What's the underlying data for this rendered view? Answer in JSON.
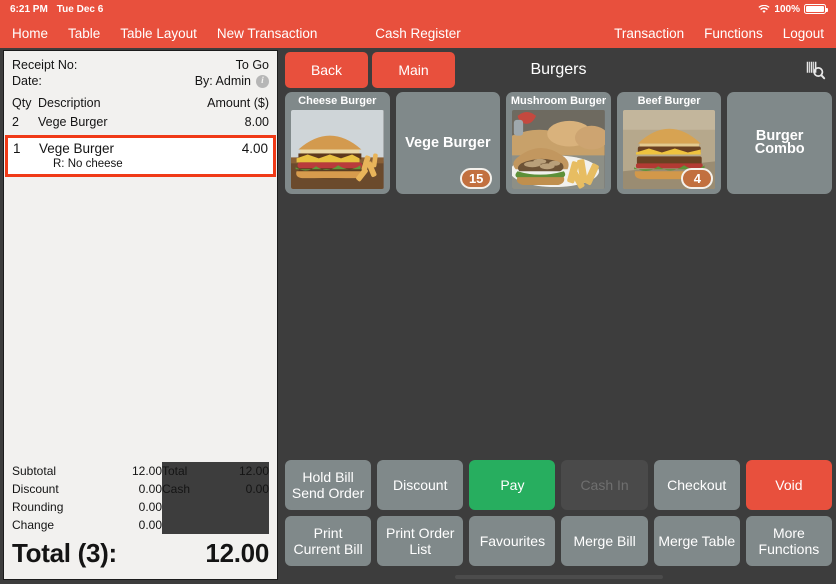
{
  "statusbar": {
    "time": "6:21 PM",
    "date": "Tue Dec 6",
    "wifi_icon": "wifi-icon",
    "battery_percent": "100%",
    "battery_icon": "battery-full-icon"
  },
  "navbar": {
    "title": "Cash Register",
    "left_items": [
      {
        "label": "Home",
        "name": "nav-item-home"
      },
      {
        "label": "Table",
        "name": "nav-item-table"
      },
      {
        "label": "Table Layout",
        "name": "nav-item-table-layout"
      },
      {
        "label": "New Transaction",
        "name": "nav-item-new-transaction"
      }
    ],
    "right_items": [
      {
        "label": "Transaction",
        "name": "nav-item-transaction"
      },
      {
        "label": "Functions",
        "name": "nav-item-functions"
      },
      {
        "label": "Logout",
        "name": "nav-item-logout"
      }
    ]
  },
  "receipt": {
    "receipt_no_label": "Receipt No:",
    "receipt_no_value": "",
    "order_type": "To Go",
    "date_label": "Date:",
    "date_value": "",
    "operator": "By: Admin",
    "info_icon": "info-icon",
    "col_qty": "Qty",
    "col_desc": "Description",
    "col_amount": "Amount ($)",
    "items": [
      {
        "qty": "2",
        "description": "Vege Burger",
        "amount": "8.00",
        "note": "",
        "selected": false
      },
      {
        "qty": "1",
        "description": "Vege Burger",
        "amount": "4.00",
        "note": "R: No cheese",
        "selected": true
      }
    ],
    "totals_left": [
      {
        "label": "Subtotal",
        "value": "12.00"
      },
      {
        "label": "Discount",
        "value": "0.00"
      },
      {
        "label": "Rounding",
        "value": "0.00"
      },
      {
        "label": "Change",
        "value": "0.00"
      }
    ],
    "totals_right": [
      {
        "label": "Total",
        "value": "12.00"
      },
      {
        "label": "Cash",
        "value": "0.00"
      }
    ],
    "grand_label": "Total (3):",
    "grand_value": "12.00"
  },
  "products": {
    "back_label": "Back",
    "main_label": "Main",
    "category_title": "Burgers",
    "search_icon": "barcode-search-icon",
    "tiles": [
      {
        "name": "Cheese Burger",
        "has_image": true,
        "image": "cheese-burger-photo",
        "badge": ""
      },
      {
        "name": "Vege Burger",
        "has_image": false,
        "image": "",
        "badge": "15"
      },
      {
        "name": "Mushroom Burger",
        "has_image": true,
        "image": "mushroom-burger-photo",
        "badge": ""
      },
      {
        "name": "Beef Burger",
        "has_image": true,
        "image": "beef-burger-photo",
        "badge": "4"
      },
      {
        "name": "Burger Combo",
        "has_image": false,
        "image": "",
        "badge": ""
      }
    ]
  },
  "actions": {
    "row1": [
      {
        "label": "Hold Bill\nSend Order",
        "name": "hold-bill-send-order-button",
        "style": "default"
      },
      {
        "label": "Discount",
        "name": "discount-button",
        "style": "default"
      },
      {
        "label": "Pay",
        "name": "pay-button",
        "style": "green"
      },
      {
        "label": "Cash In",
        "name": "cash-in-button",
        "style": "disabled"
      },
      {
        "label": "Checkout",
        "name": "checkout-button",
        "style": "default"
      },
      {
        "label": "Void",
        "name": "void-button",
        "style": "red"
      }
    ],
    "row2": [
      {
        "label": "Print\nCurrent Bill",
        "name": "print-current-bill-button",
        "style": "default"
      },
      {
        "label": "Print Order\nList",
        "name": "print-order-list-button",
        "style": "default"
      },
      {
        "label": "Favourites",
        "name": "favourites-button",
        "style": "default"
      },
      {
        "label": "Merge Bill",
        "name": "merge-bill-button",
        "style": "default"
      },
      {
        "label": "Merge Table",
        "name": "merge-table-button",
        "style": "default"
      },
      {
        "label": "More\nFunctions",
        "name": "more-functions-button",
        "style": "default"
      }
    ]
  },
  "colors": {
    "brand_red": "#e8503d",
    "tile_gray": "#80898a",
    "pay_green": "#27ae5f",
    "badge_orange": "#c2703f",
    "panel_dark": "#3d3d3d",
    "receipt_paper": "#f2f1ef",
    "select_outline": "#f03a17"
  }
}
